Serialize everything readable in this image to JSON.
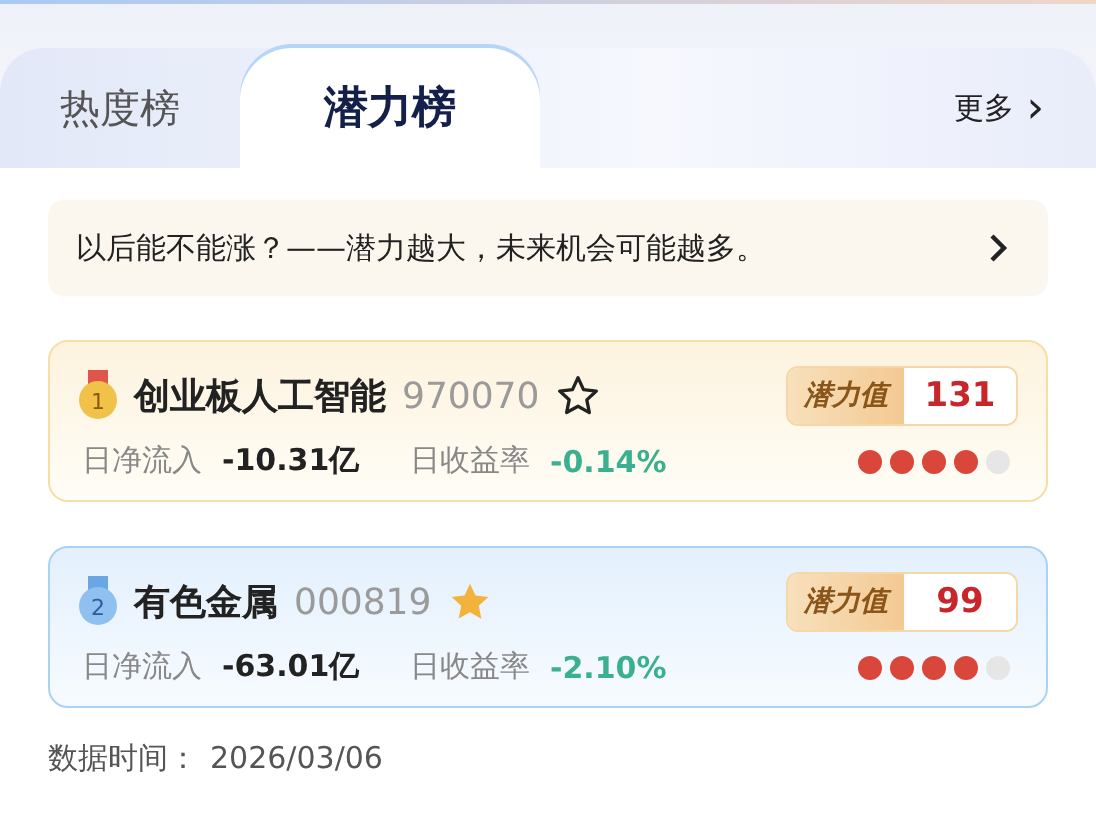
{
  "tabs": [
    {
      "label": "热度榜",
      "selected": false
    },
    {
      "label": "潜力榜",
      "selected": true
    }
  ],
  "more": {
    "label": "更多",
    "icon": "›"
  },
  "banner": {
    "text": "以后能不能涨？——潜力越大，未来机会可能越多。"
  },
  "cards": [
    {
      "kind": "gold",
      "rank": "1",
      "name": "创业板人工智能",
      "code": "970070",
      "favorite": false,
      "score_label": "潜力值",
      "score": "131",
      "flow_label": "日净流入",
      "flow": "-10.31亿",
      "return_label": "日收益率",
      "return": "-0.14%",
      "stars": 4
    },
    {
      "kind": "silver",
      "rank": "2",
      "name": "有色金属",
      "code": "000819",
      "favorite": true,
      "score_label": "潜力值",
      "score": "99",
      "flow_label": "日净流入",
      "flow": "-63.01亿",
      "return_label": "日收益率",
      "return": "-2.10%",
      "stars": 4
    }
  ],
  "footer": {
    "label": "数据时间：",
    "date": "2026/03/06"
  }
}
